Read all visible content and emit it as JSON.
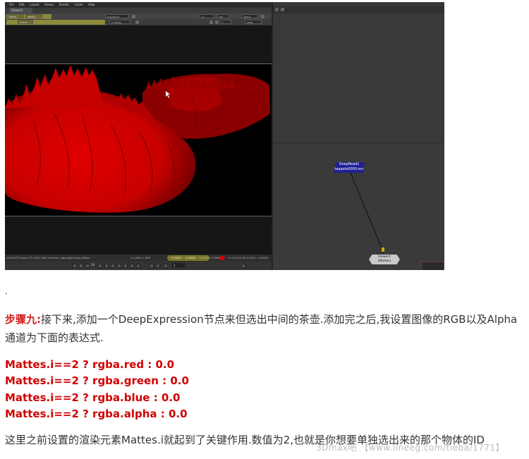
{
  "screenshot": {
    "menu": [
      "File",
      "Edit",
      "Layout",
      "Viewer",
      "Render",
      "Cache",
      "Help"
    ],
    "viewer_tab": "Viewer1",
    "toolbar_row1": [
      "Mattes",
      "Mattes.i",
      "DeepRead1",
      "Y 1",
      "100",
      "default",
      "0.000000"
    ],
    "toolbar_row2_value": "0.1111",
    "toolbar_right": [
      "1",
      "sRGB"
    ],
    "status_text": "1919x1079 bbox: 0 0 1920 1080 channels: rgba,depth,deep,Mattes",
    "status_coords": "x=1180 y= 896",
    "status_values": [
      "0.00000",
      "0.00000",
      "0.00000",
      "0.00000"
    ],
    "status_right": "H: 0.00 S:0.00 V:1.00  L: 0.42500",
    "timeline_frame": "1",
    "timeline_fps": "24",
    "node_read": {
      "line1": "DeepRead1",
      "line2": "teapots0000.exr"
    },
    "node_viewer": {
      "line1": "Viewer1",
      "line2": "(Mattes)"
    },
    "colors": {
      "read_node": "#1f1f95",
      "viewer_node": "#c9c9c9",
      "matte_red": "#c80000"
    }
  },
  "article": {
    "dot": ".",
    "step_label": "步骤九:",
    "paragraph": "接下来,添加一个DeepExpression节点来但选出中间的茶壶.添加完之后,我设置图像的RGB以及Alpha通道为下面的表达式.",
    "expressions": [
      "Mattes.i==2 ? rgba.red : 0.0",
      "Mattes.i==2 ? rgba.green : 0.0",
      "Mattes.i==2 ? rgba.blue : 0.0",
      "Mattes.i==2 ? rgba.alpha : 0.0"
    ],
    "paragraph2": "这里之前设置的渲染元素Mattes.i就起到了关键作用.数值为2,也就是你想要单独选出来的那个物体的ID",
    "watermark": "3Dmax吧 【www.lineeg.com/tieba/1771】"
  }
}
